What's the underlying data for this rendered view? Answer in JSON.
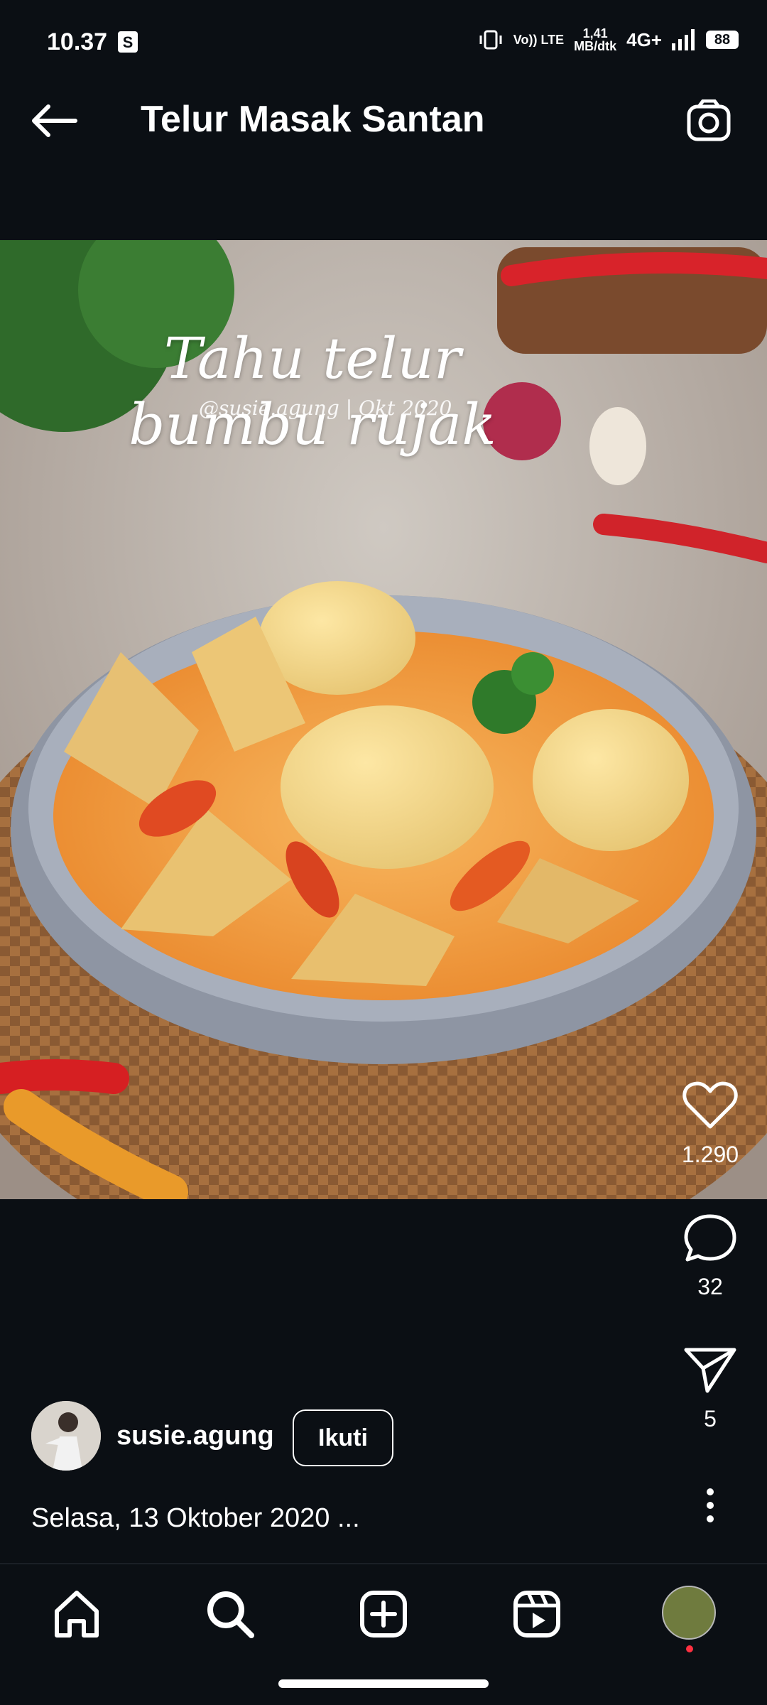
{
  "status_bar": {
    "time": "10.37",
    "shop_icon": "shopping-bag-icon",
    "volte_label": "Vo)) LTE",
    "speed_value": "1,41",
    "speed_unit": "MB/dtk",
    "network": "4G+",
    "battery": "88"
  },
  "header": {
    "title": "Telur Masak Santan",
    "back_icon": "arrow-left-icon",
    "camera_icon": "camera-icon"
  },
  "post": {
    "image_caption": "Tahu telur bumbu rujak",
    "image_credit": "@susie.agung | Okt 2020",
    "likes": "1.290",
    "comments": "32",
    "shares": "5",
    "username": "susie.agung",
    "follow_label": "Ikuti",
    "caption": "Selasa, 13 Oktober 2020 ..."
  },
  "bottom_nav": {
    "items": [
      {
        "name": "home",
        "icon": "home-icon"
      },
      {
        "name": "search",
        "icon": "search-icon"
      },
      {
        "name": "create",
        "icon": "plus-square-icon"
      },
      {
        "name": "reels",
        "icon": "reels-icon"
      },
      {
        "name": "profile",
        "icon": "avatar-icon"
      }
    ]
  },
  "colors": {
    "background": "#0b0f14",
    "text": "#ffffff",
    "notification_dot": "#ff3040"
  }
}
